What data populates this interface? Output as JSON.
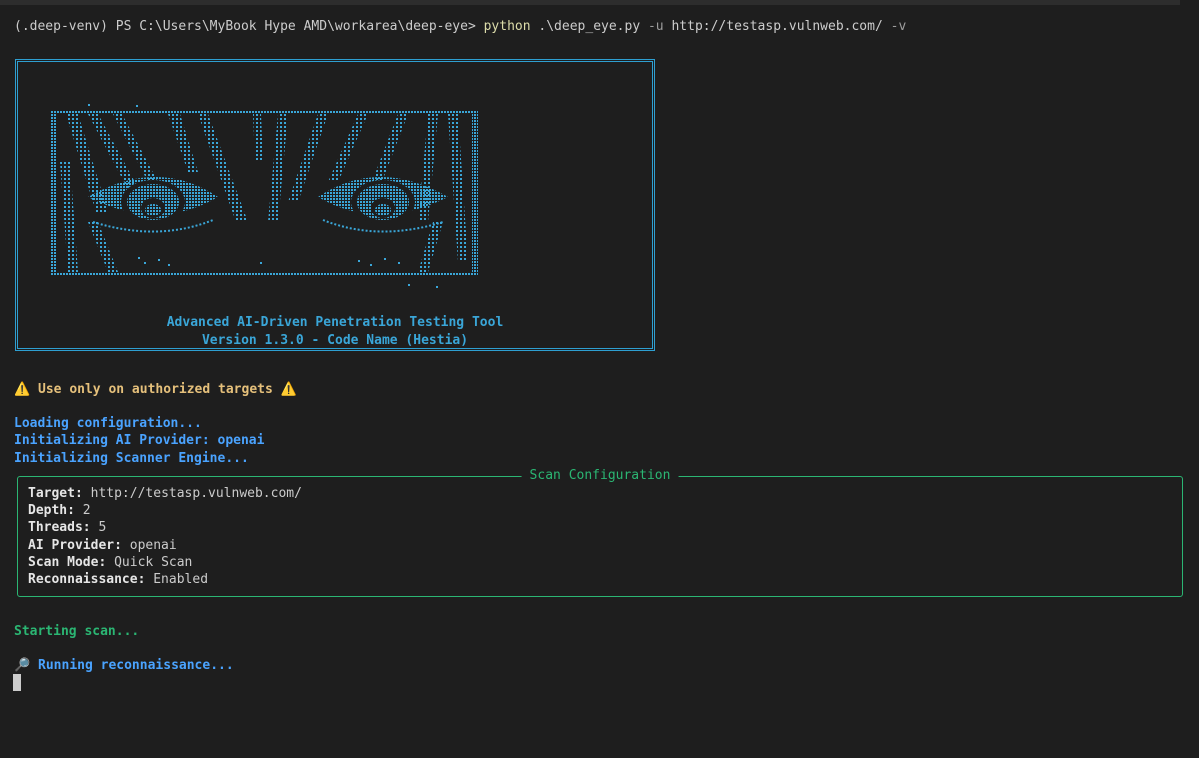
{
  "terminal": {
    "prompt_env": "(.deep-venv)",
    "prompt_ps": "PS C:\\Users\\MyBook Hype AMD\\workarea\\deep-eye>",
    "cmd": "python",
    "cmd_script": ".\\deep_eye.py",
    "flag_u": "-u",
    "url": "http://testasp.vulnweb.com/",
    "flag_v": "-v"
  },
  "banner": {
    "tagline": "Advanced AI-Driven Penetration Testing Tool",
    "version": "Version 1.3.0 - Code Name (Hestia)",
    "art_icon": "ascii-eyes-art",
    "border_color": "#2e9fd1"
  },
  "warning": {
    "icon": "⚠️",
    "text": " Use only on authorized targets "
  },
  "logs": {
    "line1": "Loading configuration...",
    "line2": "Initializing AI Provider: openai",
    "line3": "Initializing Scanner Engine..."
  },
  "scan_config": {
    "title": "Scan Configuration",
    "target_label": "Target:",
    "target_value": " http://testasp.vulnweb.com/",
    "depth_label": "Depth:",
    "depth_value": " 2",
    "threads_label": "Threads:",
    "threads_value": " 5",
    "provider_label": "AI Provider:",
    "provider_value": " openai",
    "mode_label": "Scan Mode:",
    "mode_value": " Quick Scan",
    "recon_label": "Reconnaissance:",
    "recon_value": " Enabled",
    "border_color": "#2bb673"
  },
  "status": {
    "starting": "Starting scan...",
    "recon_icon": "🔎",
    "running": " Running reconnaissance..."
  }
}
